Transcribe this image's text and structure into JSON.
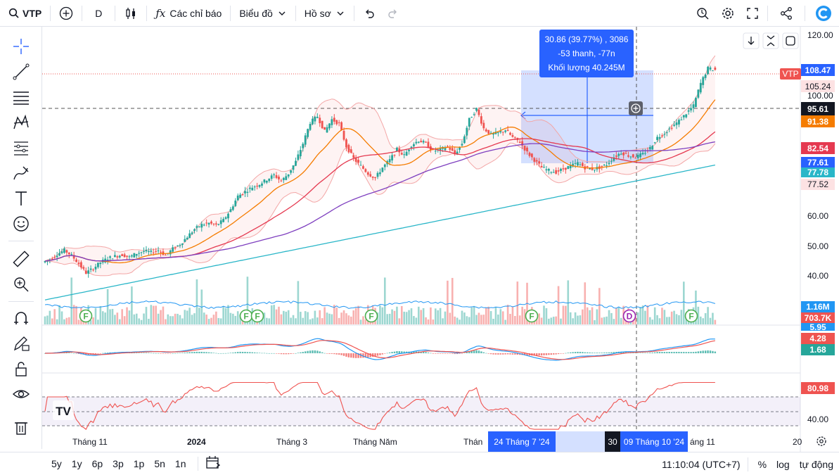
{
  "toolbar": {
    "symbol": "VTP",
    "interval": "D",
    "indicators_label": "Các chỉ báo",
    "chart_type_label": "Biểu đồ",
    "profile_label": "Hồ sơ"
  },
  "measure_tooltip": {
    "line1": "30.86 (39.77%) , 3086",
    "line2": "-53 thanh, -77n",
    "line3": "Khối lượng 40.245M"
  },
  "price_scale": {
    "ticks": [
      "120.00",
      "100.00",
      "60.00",
      "50.00",
      "40.00"
    ],
    "rsi_tick": "40.00"
  },
  "price_labels": {
    "symbol_tag": "VTP",
    "last": "108.47",
    "ma1": "105.24",
    "crosshair": "95.61",
    "ma2": "91.38",
    "ma3": "82.54",
    "ma4": "77.61",
    "ma5": "77.78",
    "ma6": "77.52",
    "vol1": "1.16M",
    "vol2": "703.7K",
    "macd1": "5.95",
    "macd2": "4.28",
    "macd3": "1.68",
    "rsi": "80.98"
  },
  "time_axis": {
    "labels": [
      "Tháng 11",
      "2024",
      "Tháng 3",
      "Tháng Năm",
      "Thán",
      "30",
      "áng 11",
      "20"
    ],
    "range_start": "24 Tháng 7 '24",
    "range_end": "09 Tháng 10 '24"
  },
  "event_markers": [
    "F",
    "F",
    "F",
    "F",
    "F",
    "D",
    "F"
  ],
  "bottombar": {
    "ranges": [
      "5y",
      "1y",
      "6p",
      "3p",
      "1p",
      "5n",
      "1n"
    ],
    "clock": "11:10:04 (UTC+7)",
    "percent": "%",
    "log": "log",
    "auto": "tự động"
  },
  "colors": {
    "up": "#26a69a",
    "down": "#ef5350",
    "accent": "#2962ff",
    "ma_orange": "#f57c00",
    "ma_red": "#e53950",
    "ma_purple": "#7e3fbf",
    "ma_cyan": "#29b6c8",
    "selection": "#2962ff"
  },
  "chart_data": {
    "type": "candlestick",
    "symbol": "VTP",
    "interval": "D",
    "ylim": [
      35,
      122
    ],
    "closes": [
      45.5,
      47.2,
      48.5,
      46.8,
      44.0,
      41.0,
      42.5,
      44.5,
      45.8,
      46.5,
      47.0,
      46.2,
      47.5,
      48.2,
      47.8,
      48.5,
      46.8,
      49.0,
      50.5,
      53.0,
      55.5,
      57.0,
      57.5,
      56.8,
      58.5,
      62.0,
      66.5,
      68.0,
      69.5,
      70.5,
      72.0,
      73.5,
      71.5,
      74.0,
      78.0,
      84.0,
      91.0,
      93.0,
      88.0,
      92.0,
      90.5,
      83.0,
      79.0,
      76.5,
      74.0,
      72.5,
      76.0,
      78.5,
      82.0,
      80.0,
      83.5,
      85.0,
      84.0,
      81.5,
      82.0,
      83.0,
      80.5,
      84.0,
      92.0,
      95.5,
      89.0,
      87.0,
      87.5,
      88.5,
      86.0,
      84.5,
      81.0,
      78.5,
      76.0,
      75.0,
      74.5,
      75.5,
      76.5,
      77.5,
      76.0,
      75.5,
      76.0,
      77.0,
      79.5,
      81.0,
      80.0,
      79.5,
      80.5,
      82.5,
      86.0,
      87.5,
      89.5,
      91.5,
      94.0,
      96.5,
      104.0,
      109.0,
      108.47
    ],
    "volume_indicator": {
      "values": [
        "1.16M",
        "703.7K"
      ]
    },
    "macd": {
      "values": [
        "5.95",
        "4.28",
        "1.68"
      ]
    },
    "rsi": {
      "value": "80.98"
    }
  }
}
